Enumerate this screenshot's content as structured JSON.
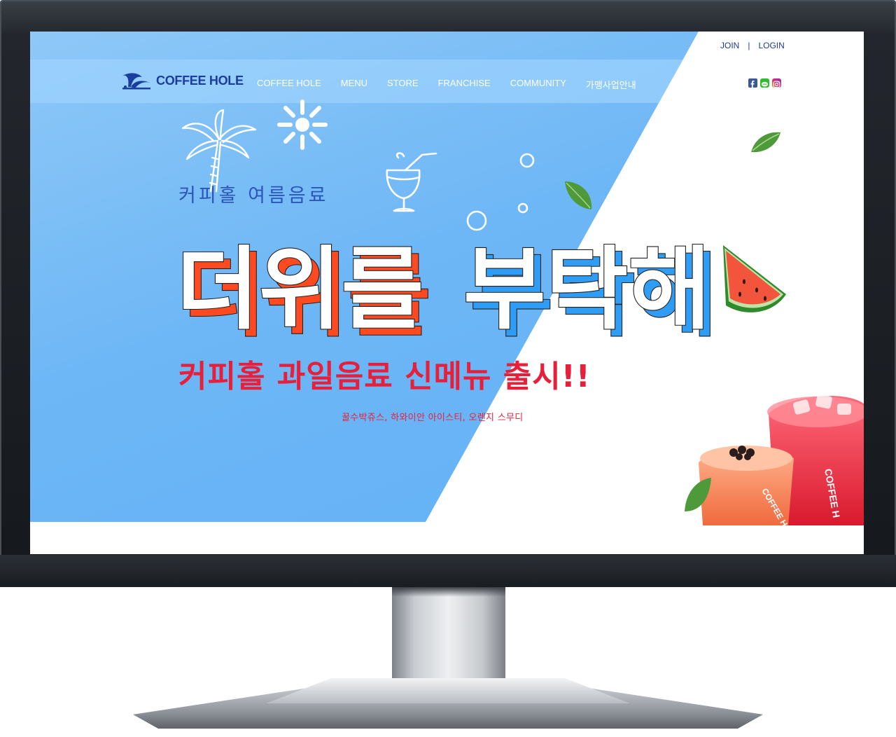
{
  "brand": {
    "name": "COFFEE HOLE",
    "colors": {
      "primary_blue": "#6eb7f6",
      "logo_navy": "#1a3e9e",
      "promo_red": "#e81f3a",
      "headline_orange": "#ff4a21",
      "headline_blue": "#2f9cf5"
    }
  },
  "topbar": {
    "join_label": "JOIN",
    "separator": "|",
    "login_label": "LOGIN"
  },
  "nav": {
    "items": [
      {
        "label": "COFFEE HOLE"
      },
      {
        "label": "MENU"
      },
      {
        "label": "STORE"
      },
      {
        "label": "FRANCHISE"
      },
      {
        "label": "COMMUNITY"
      },
      {
        "label": "가맹사업안내"
      }
    ]
  },
  "social": {
    "icons": [
      "facebook-icon",
      "line-icon",
      "instagram-icon"
    ]
  },
  "hero": {
    "kicker": "커피홀 여름음료",
    "headline_part1": "더위를",
    "headline_part2": "부탁해",
    "promo": "커피홀 과일음료 신메뉴 출시!!",
    "menu_list": "꿀수박쥬스, 하와이안 아이스티, 오렌지 스무디",
    "cup_label": "COFFEE HOLE",
    "cup_label_short": "COFFEE H"
  }
}
